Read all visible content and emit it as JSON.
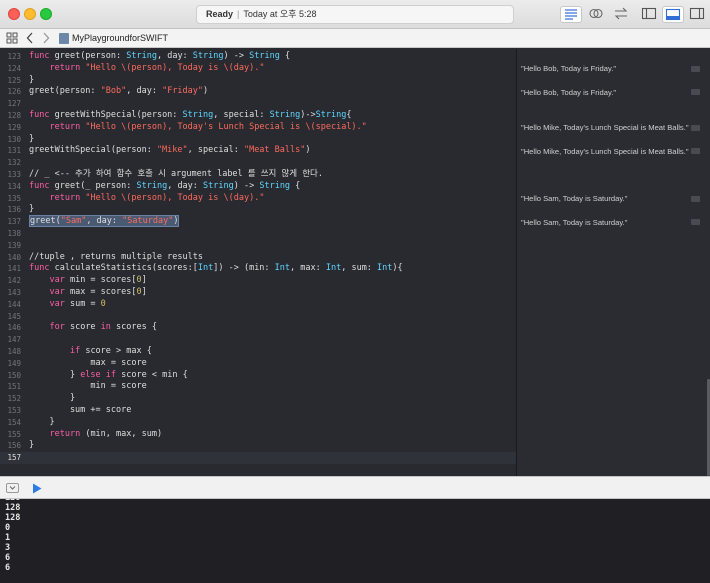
{
  "titlebar": {
    "status_label": "Ready",
    "status_separator": "|",
    "status_detail": "Today at 오후 5:28"
  },
  "navbar": {
    "breadcrumb": "MyPlaygroundforSWIFT"
  },
  "editor": {
    "lines": [
      {
        "num": "123",
        "top": 0
      },
      {
        "num": "124"
      },
      {
        "num": "125"
      },
      {
        "num": "126"
      },
      {
        "num": "127"
      },
      {
        "num": "128"
      },
      {
        "num": "129"
      },
      {
        "num": "130"
      },
      {
        "num": "131"
      },
      {
        "num": "132"
      },
      {
        "num": "133"
      },
      {
        "num": "134"
      },
      {
        "num": "135"
      },
      {
        "num": "136"
      },
      {
        "num": "137"
      },
      {
        "num": "138"
      },
      {
        "num": "139"
      },
      {
        "num": "140"
      },
      {
        "num": "141"
      },
      {
        "num": "142"
      },
      {
        "num": "143"
      },
      {
        "num": "144"
      },
      {
        "num": "145"
      },
      {
        "num": "146"
      },
      {
        "num": "147"
      },
      {
        "num": "148"
      },
      {
        "num": "149"
      },
      {
        "num": "150"
      },
      {
        "num": "151"
      },
      {
        "num": "152"
      },
      {
        "num": "153"
      },
      {
        "num": "154"
      },
      {
        "num": "155"
      },
      {
        "num": "156"
      },
      {
        "num": "157"
      }
    ]
  },
  "code": {
    "l123": [
      "func",
      " greet(person: ",
      "String",
      ", day: ",
      "String",
      ") -> ",
      "String",
      " {"
    ],
    "l124": [
      "    ",
      "return",
      " ",
      "\"Hello \\(person), Today is \\(day).\""
    ],
    "l125": "}",
    "l126": [
      "greet(person: ",
      "\"Bob\"",
      ", day: ",
      "\"Friday\"",
      ")"
    ],
    "l127": "",
    "l128": [
      "func",
      " greetWithSpecial(person: ",
      "String",
      ", special: ",
      "String",
      ")->",
      "String",
      "{"
    ],
    "l129": [
      "    ",
      "return",
      " ",
      "\"Hello \\(person), Today's Lunch Special is \\(special).\""
    ],
    "l130": "}",
    "l131": [
      "greetWithSpecial(person: ",
      "\"Mike\"",
      ", special: ",
      "\"Meat Balls\"",
      ")"
    ],
    "l132": "",
    "l133": "// _ <-- 추가 하여 함수 호출 시 argument label 를 쓰지 않게 한다.",
    "l134": [
      "func",
      " greet(_ person: ",
      "String",
      ", day: ",
      "String",
      ") -> ",
      "String",
      " {"
    ],
    "l135": [
      "    ",
      "return",
      " ",
      "\"Hello \\(person), Today is \\(day).\""
    ],
    "l136": "}",
    "l137": [
      "greet(",
      "\"Sam\"",
      ", day: ",
      "\"Saturday\"",
      ")"
    ],
    "l138": "",
    "l139": "",
    "l140": "//tuple , returns multiple results",
    "l141": [
      "func",
      " calculateStatistics(scores:[",
      "Int",
      "]) -> (min: ",
      "Int",
      ", max: ",
      "Int",
      ", sum: ",
      "Int",
      "){"
    ],
    "l142": [
      "    ",
      "var",
      " min = scores[",
      "0",
      "]"
    ],
    "l143": [
      "    ",
      "var",
      " max = scores[",
      "0",
      "]"
    ],
    "l144": [
      "    ",
      "var",
      " sum = ",
      "0"
    ],
    "l145": "",
    "l146": [
      "    ",
      "for",
      " score ",
      "in",
      " scores {"
    ],
    "l147": "",
    "l148": [
      "        ",
      "if",
      " score > max {"
    ],
    "l149": "            max = score",
    "l150": [
      "        } ",
      "else",
      " ",
      "if",
      " score < min {"
    ],
    "l151": "            min = score",
    "l152": "        }",
    "l153": "        sum += score",
    "l154": "    }",
    "l155": [
      "    ",
      "return",
      " (min, max, sum)"
    ],
    "l156": "}",
    "l157": ""
  },
  "results": {
    "r124": "\"Hello Bob, Today is Friday.\"",
    "r126": "\"Hello Bob, Today is Friday.\"",
    "r129": "\"Hello Mike, Today's Lunch Special is Meat Balls.\"",
    "r131": "\"Hello Mike, Today's Lunch Special is Meat Balls.\"",
    "r135": "\"Hello Sam, Today is Saturday.\"",
    "r137": "\"Hello Sam, Today is Saturday.\""
  },
  "console": {
    "lines": [
      "128",
      "128",
      "128",
      "0",
      "1",
      "3",
      "6",
      "6"
    ]
  },
  "colors": {
    "editor_bg": "#292a30",
    "keyword": "#fc5fa3",
    "type": "#5dd8ff",
    "string": "#fc6a5d",
    "comment": "#6c7986",
    "number": "#d0bf69"
  }
}
